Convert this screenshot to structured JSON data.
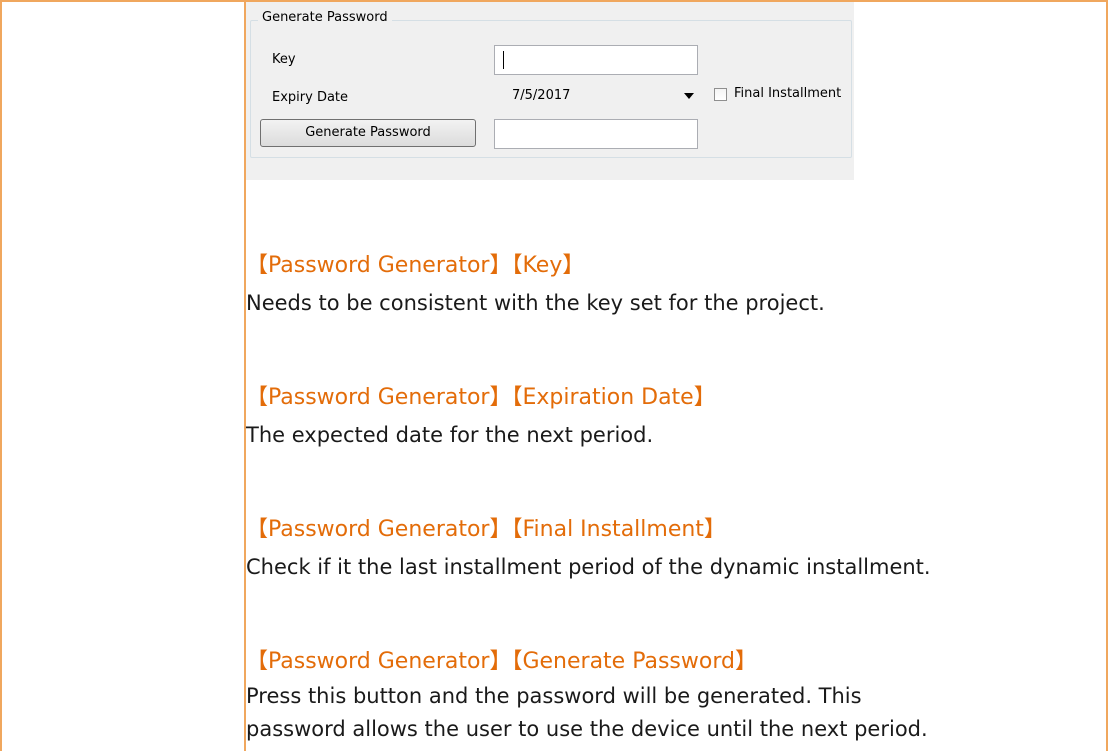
{
  "dialog": {
    "group_title": "Generate Password",
    "key_label": "Key",
    "key_value": "",
    "expiry_label": "Expiry Date",
    "expiry_value": "7/5/2017",
    "final_installment_label": "Final Installment",
    "final_installment_checked": false,
    "generate_button_label": "Generate Password",
    "generated_password_value": ""
  },
  "sections": [
    {
      "heading": "【Password Generator】【Key】",
      "body": [
        "Needs to be consistent with the key set for the project."
      ]
    },
    {
      "heading": "【Password Generator】【Expiration Date】",
      "body": [
        "The expected date for the next period."
      ]
    },
    {
      "heading": "【Password Generator】【Final Installment】",
      "body": [
        "Check if it the last installment period of the dynamic installment."
      ]
    },
    {
      "heading": "【Password Generator】【Generate Password】",
      "body": [
        "Press this button and the password will be generated. This",
        "password allows the user to use the device until the next period."
      ]
    }
  ],
  "colors": {
    "frame_border": "#f0a75e",
    "heading": "#e36c09",
    "body_text": "#1a1a1a",
    "dialog_background": "#f0f0f0"
  }
}
